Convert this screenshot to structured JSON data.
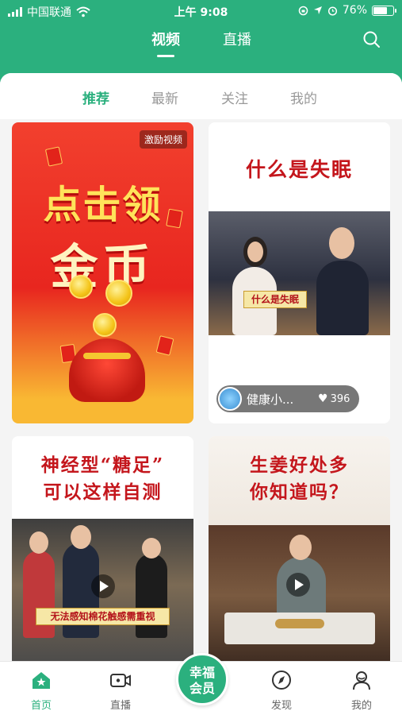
{
  "status_bar": {
    "carrier": "中国联通",
    "time": "上午 9:08",
    "battery": "76%",
    "battery_level": 0.76
  },
  "top_tabs": [
    {
      "label": "视频",
      "active": true
    },
    {
      "label": "直播",
      "active": false
    }
  ],
  "sub_tabs": [
    {
      "label": "推荐",
      "active": true
    },
    {
      "label": "最新",
      "active": false
    },
    {
      "label": "关注",
      "active": false
    },
    {
      "label": "我的",
      "active": false
    }
  ],
  "cards": [
    {
      "type": "ad",
      "badge": "激励视频",
      "line1": "点击领",
      "line2": "金币"
    },
    {
      "type": "video",
      "title": "什么是失眠",
      "caption": "什么是失眠",
      "author": "健康小...",
      "likes": "396"
    },
    {
      "type": "video",
      "title_line1": "神经型“糖足”",
      "title_line2": "可以这样自测",
      "caption": "无法感知棉花触感需重视"
    },
    {
      "type": "video",
      "title_line1": "生姜好处多",
      "title_line2": "你知道吗？"
    }
  ],
  "bottom_nav": [
    {
      "label": "首页",
      "icon": "home-icon",
      "active": true
    },
    {
      "label": "直播",
      "icon": "video-camera-icon",
      "active": false
    },
    {
      "label": "幸福会员",
      "icon": "vip-button",
      "active": false
    },
    {
      "label": "发现",
      "icon": "compass-icon",
      "active": false
    },
    {
      "label": "我的",
      "icon": "profile-icon",
      "active": false
    }
  ],
  "vip": {
    "line1": "幸福",
    "line2": "会员"
  },
  "colors": {
    "brand": "#2bb07e",
    "ad_red": "#e8261f",
    "title_red": "#c4161c"
  }
}
